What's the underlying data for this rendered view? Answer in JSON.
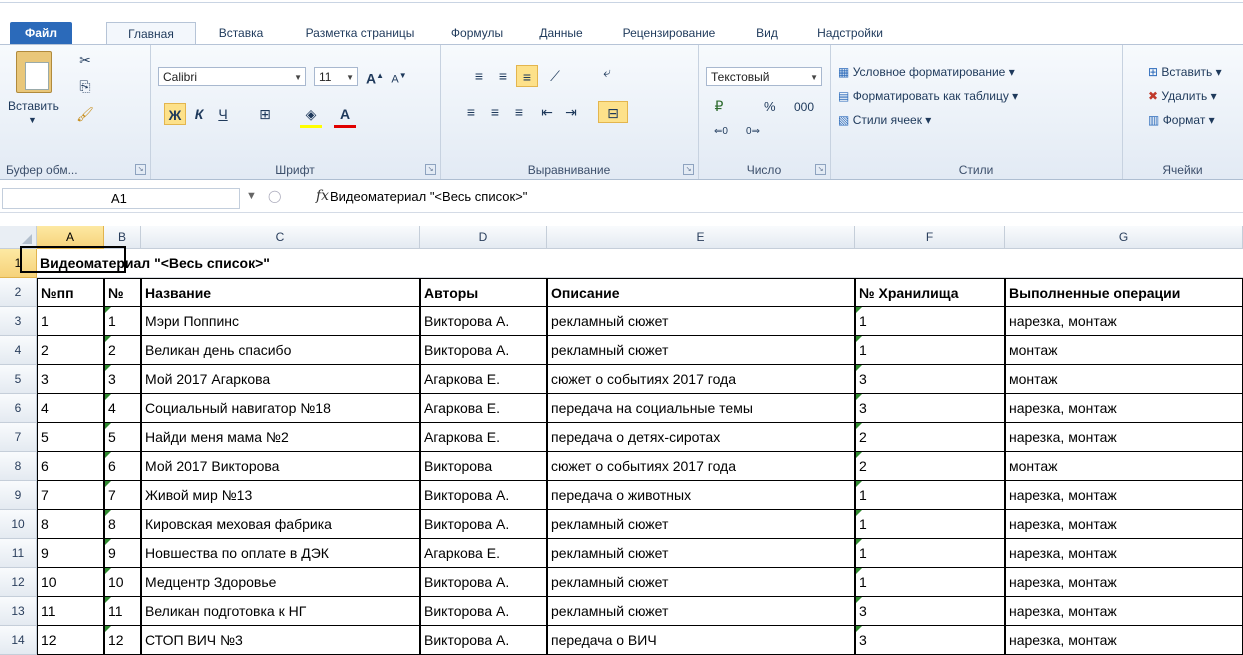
{
  "tabs": [
    "Файл",
    "Главная",
    "Вставка",
    "Разметка страницы",
    "Формулы",
    "Данные",
    "Рецензирование",
    "Вид",
    "Надстройки"
  ],
  "ribbon": {
    "clipboard": {
      "paste": "Вставить",
      "label": "Буфер обм..."
    },
    "font": {
      "name": "Calibri",
      "size": "11",
      "bold": "Ж",
      "italic": "К",
      "underline": "Ч",
      "label": "Шрифт"
    },
    "alignment": {
      "label": "Выравнивание"
    },
    "number": {
      "format": "Текстовый",
      "percent": "%",
      "thousands": "000",
      "label": "Число"
    },
    "styles": {
      "conditional": "Условное форматирование",
      "as_table": "Форматировать как таблицу",
      "cell_styles": "Стили ячеек",
      "label": "Стили"
    },
    "cells": {
      "insert": "Вставить",
      "delete": "Удалить",
      "format": "Формат",
      "label": "Ячейки"
    }
  },
  "formula_bar": {
    "name_box": "A1",
    "fx": "fx",
    "content": "Видеоматериал \"<Весь список>\""
  },
  "columns": [
    "A",
    "B",
    "C",
    "D",
    "E",
    "F",
    "G"
  ],
  "rows": [
    "1",
    "2",
    "3",
    "4",
    "5",
    "6",
    "7",
    "8",
    "9",
    "10",
    "11",
    "12",
    "13",
    "14"
  ],
  "title_cell": "Видеоматериал \"<Весь список>\"",
  "headers": [
    "№пп",
    "№",
    "Название",
    "Авторы",
    "Описание",
    "№ Хранилища",
    "Выполненные операции"
  ],
  "data": [
    [
      "1",
      "1",
      "Мэри Поппинс",
      "Викторова А.",
      "рекламный сюжет",
      "1",
      "нарезка, монтаж"
    ],
    [
      "2",
      "2",
      "Великан день спасибо",
      "Викторова А.",
      "рекламный сюжет",
      "1",
      "монтаж"
    ],
    [
      "3",
      "3",
      "Мой 2017 Агаркова",
      "Агаркова Е.",
      "сюжет о событиях 2017 года",
      "3",
      "монтаж"
    ],
    [
      "4",
      "4",
      "Социальный навигатор №18",
      "Агаркова Е.",
      "передача на социальные темы",
      "3",
      "нарезка, монтаж"
    ],
    [
      "5",
      "5",
      "Найди меня мама №2",
      "Агаркова Е.",
      "передача о детях-сиротах",
      "2",
      "нарезка, монтаж"
    ],
    [
      "6",
      "6",
      "Мой 2017 Викторова",
      "Викторова",
      "сюжет о событиях 2017 года",
      "2",
      "монтаж"
    ],
    [
      "7",
      "7",
      "Живой мир №13",
      "Викторова А.",
      "передача о животных",
      "1",
      "нарезка, монтаж"
    ],
    [
      "8",
      "8",
      "Кировская меховая фабрика",
      "Викторова А.",
      "рекламный сюжет",
      "1",
      "нарезка, монтаж"
    ],
    [
      "9",
      "9",
      "Новшества по оплате в ДЭК",
      "Агаркова Е.",
      "рекламный сюжет",
      "1",
      "нарезка, монтаж"
    ],
    [
      "10",
      "10",
      "Медцентр Здоровье",
      "Викторова А.",
      "рекламный сюжет",
      "1",
      "нарезка, монтаж"
    ],
    [
      "11",
      "11",
      "Великан подготовка к НГ",
      "Викторова А.",
      "рекламный сюжет",
      "3",
      "нарезка, монтаж"
    ],
    [
      "12",
      "12",
      "СТОП ВИЧ №3",
      "Викторова А.",
      "передача о ВИЧ",
      "3",
      "нарезка, монтаж"
    ]
  ]
}
